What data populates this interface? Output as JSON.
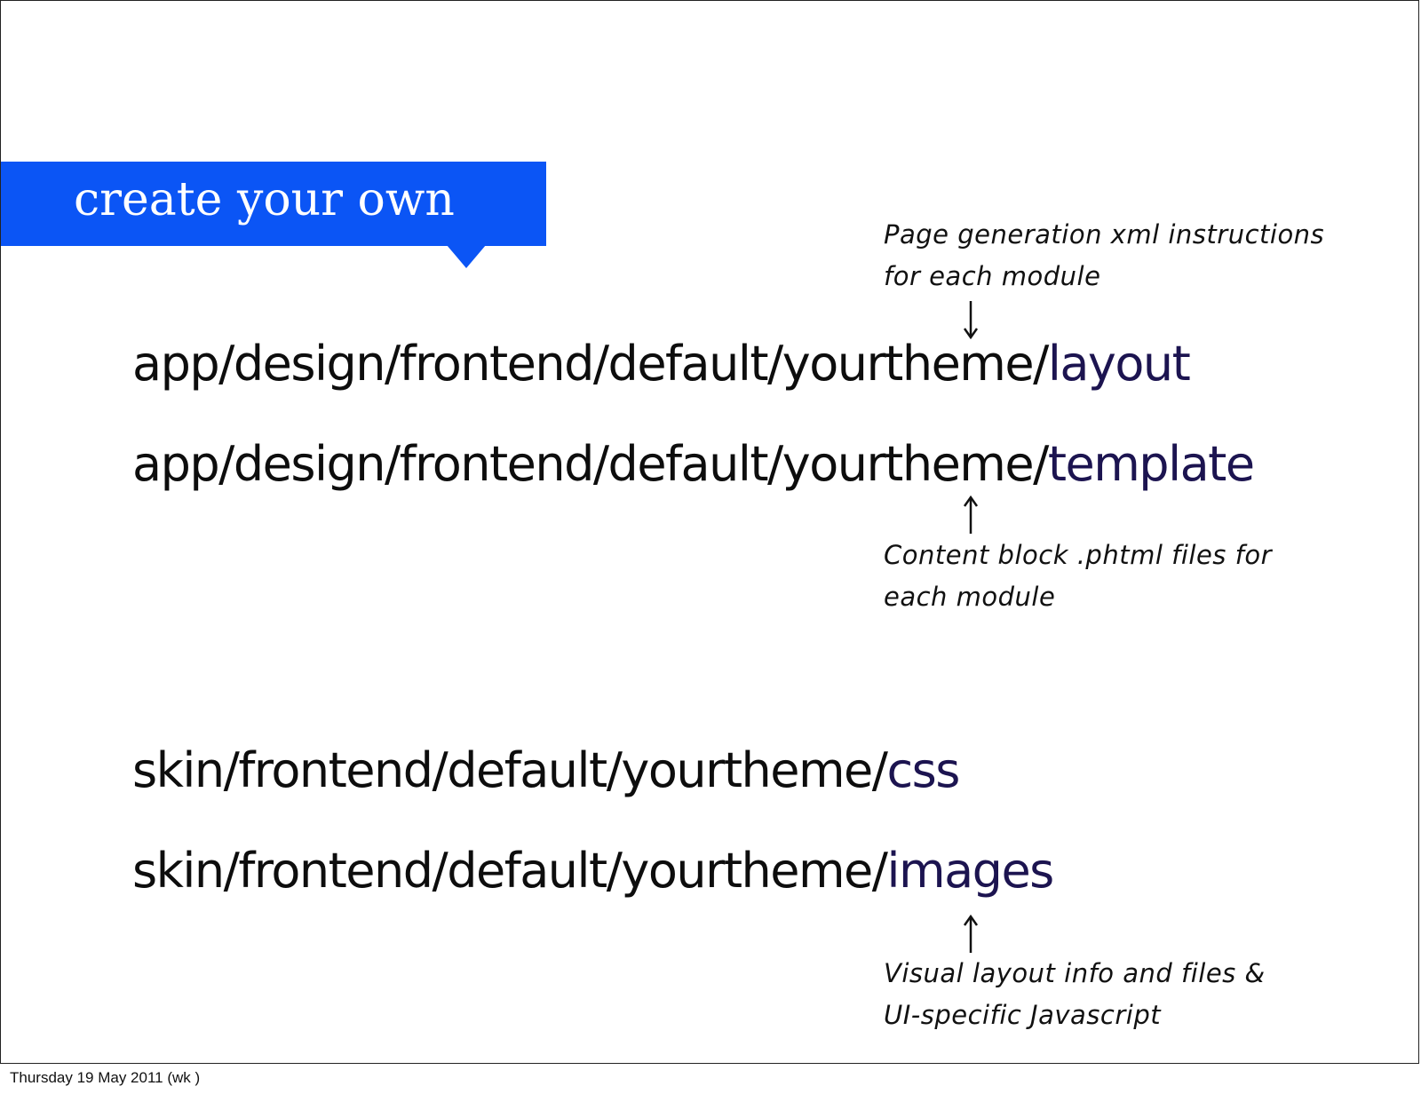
{
  "slide": {
    "title": "create your own",
    "paths": [
      {
        "prefix": "app/design/frontend/default/yourtheme/",
        "accent": "layout"
      },
      {
        "prefix": "app/design/frontend/default/yourtheme/",
        "accent": "template"
      },
      {
        "prefix": "skin/frontend/default/yourtheme/",
        "accent": "css"
      },
      {
        "prefix": "skin/frontend/default/yourtheme/",
        "accent": "images"
      }
    ],
    "notes": {
      "layout": {
        "line1": "Page generation xml instructions",
        "line2": "for each module",
        "arrow_icon": "arrow-down-icon"
      },
      "template": {
        "line1": "Content block .phtml files for",
        "line2": "each module",
        "arrow_icon": "arrow-up-icon"
      },
      "images": {
        "line1": "Visual layout info and files &",
        "line2": "UI-specific Javascript",
        "arrow_icon": "arrow-up-icon"
      }
    },
    "colors": {
      "banner": "#0b55f5",
      "accent_text": "#1c1450",
      "body_text": "#0d0d0d"
    }
  },
  "footer": {
    "date": "Thursday 19 May 2011 (wk )"
  }
}
